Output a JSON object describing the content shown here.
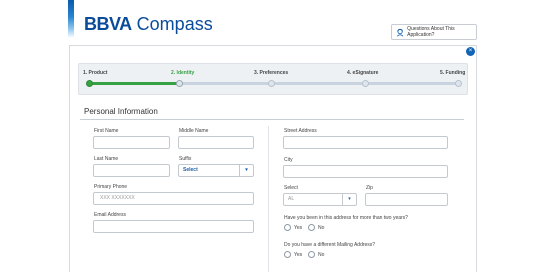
{
  "header": {
    "logo_bold": "BBVA",
    "logo_light": " Compass",
    "help_label": "Questions About This Application?"
  },
  "close_glyph": "×",
  "steps": [
    {
      "label": "1. Product",
      "state": "done"
    },
    {
      "label": "2. Identity",
      "state": "active"
    },
    {
      "label": "3. Preferences",
      "state": "pending"
    },
    {
      "label": "4. eSignature",
      "state": "pending"
    },
    {
      "label": "5. Funding",
      "state": "pending"
    }
  ],
  "section": {
    "title": "Personal Information"
  },
  "left": {
    "first_name_label": "First Name",
    "middle_name_label": "Middle Name",
    "last_name_label": "Last Name",
    "suffix_label": "Suffix",
    "suffix_value": "Select",
    "primary_phone_label": "Primary Phone",
    "primary_phone_placeholder": "XXX XXXXXXX",
    "email_label": "Email Address"
  },
  "right": {
    "street_label": "Street Address",
    "city_label": "City",
    "state_label": "Select",
    "state_value": "AL",
    "zip_label": "Zip",
    "two_years_question": "Have you been in this address for more than two years?",
    "mailing_question": "Do you have a different Mailing Address?",
    "yes_label": "Yes",
    "no_label": "No"
  },
  "caret_glyph": "▾",
  "colors": {
    "brand": "#0a4c9a",
    "active_step": "#35a143",
    "close_button": "#1464b4"
  }
}
